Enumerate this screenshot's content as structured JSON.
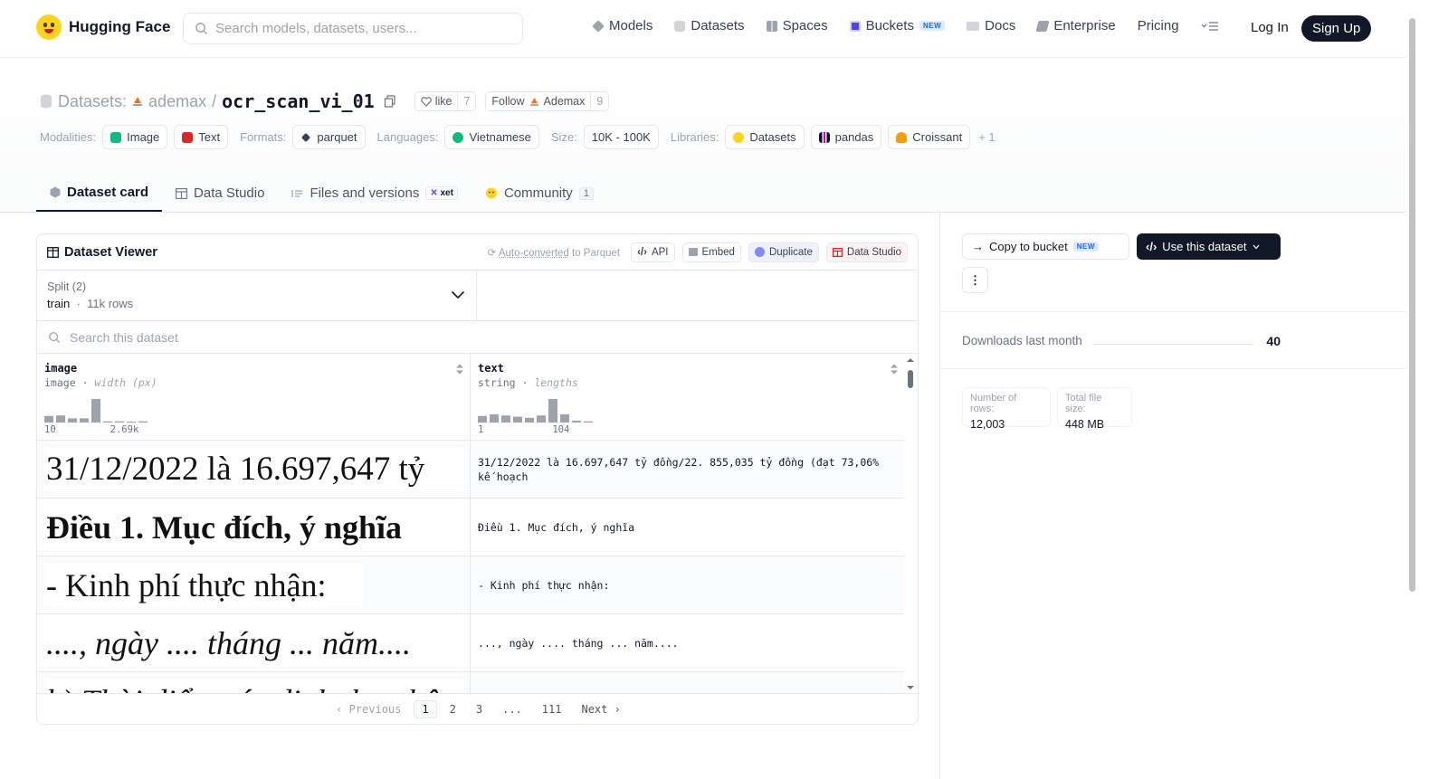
{
  "nav": {
    "brand": "Hugging Face",
    "search_placeholder": "Search models, datasets, users...",
    "links": {
      "models": "Models",
      "datasets": "Datasets",
      "spaces": "Spaces",
      "buckets": "Buckets",
      "buckets_badge": "NEW",
      "docs": "Docs",
      "enterprise": "Enterprise",
      "pricing": "Pricing"
    },
    "login": "Log In",
    "signup": "Sign Up"
  },
  "header": {
    "prefix": "Datasets:",
    "owner": "ademax",
    "name": "ocr_scan_vi_01",
    "like_label": "like",
    "like_count": "7",
    "follow_label": "Follow",
    "follow_user": "Ademax",
    "follow_count": "9"
  },
  "meta": {
    "modalities_label": "Modalities:",
    "modalities": [
      "Image",
      "Text"
    ],
    "formats_label": "Formats:",
    "format": "parquet",
    "languages_label": "Languages:",
    "language": "Vietnamese",
    "size_label": "Size:",
    "size": "10K - 100K",
    "libraries_label": "Libraries:",
    "libraries": [
      "Datasets",
      "pandas",
      "Croissant"
    ],
    "more_libraries": "+ 1"
  },
  "tabs": {
    "card": "Dataset card",
    "studio": "Data Studio",
    "files": "Files and versions",
    "xet": "xet",
    "community": "Community",
    "community_count": "1"
  },
  "viewer": {
    "title": "Dataset Viewer",
    "auto_converted": "Auto-converted",
    "to_parquet": " to Parquet",
    "api": "API",
    "embed": "Embed",
    "duplicate": "Duplicate",
    "data_studio": "Data Studio",
    "split_label": "Split (2)",
    "split_value": "train",
    "split_rows": "11k rows",
    "search_placeholder": "Search this dataset",
    "columns": [
      {
        "name": "image",
        "type": "image",
        "stat": "width (px)",
        "min": "10",
        "max": "2.69k",
        "hist": [
          0.28,
          0.3,
          0.18,
          0.18,
          1.0,
          0.05,
          0.05,
          0.0,
          0.05
        ]
      },
      {
        "name": "text",
        "type": "string",
        "stat": "lengths",
        "min": "1",
        "max": "104",
        "hist": [
          0.28,
          0.35,
          0.3,
          0.25,
          0.2,
          0.3,
          1.0,
          0.35,
          0.08,
          0.05
        ]
      }
    ],
    "rows": [
      {
        "image_text": "31/12/2022  là  16.697,647  tỷ",
        "text": "31/12/2022 là 16.697,647 tỷ đồng/22. 855,035 tỷ đồng (đạt 73,06% kế hoạch"
      },
      {
        "image_text": "Điều 1. Mục đích, ý nghĩa",
        "text": "Điều 1. Mục đích, ý nghĩa"
      },
      {
        "image_text": "- Kinh phí thực nhận:",
        "text": "- Kinh phí thực nhận:"
      },
      {
        "image_text": "...., ngày .... tháng ... năm....",
        "text": "..., ngày .... tháng ... năm...."
      },
      {
        "image_text": "b) Thời điểm xác định thu nhập",
        "text": ""
      }
    ],
    "pager": {
      "prev": "Previous",
      "pages": [
        "1",
        "2",
        "3",
        "...",
        "111"
      ],
      "next": "Next"
    }
  },
  "sidebar": {
    "copy_to_bucket": "Copy to bucket",
    "copy_badge": "NEW",
    "use_dataset": "Use this dataset",
    "downloads_label": "Downloads last month",
    "downloads_value": "40",
    "rows_label": "Number of rows:",
    "rows_value": "12,003",
    "size_label": "Total file size:",
    "size_value": "448 MB"
  },
  "colors": {
    "accent_dark": "#111827",
    "hf_yellow": "#ffd21e",
    "new_badge": "#2563eb"
  }
}
